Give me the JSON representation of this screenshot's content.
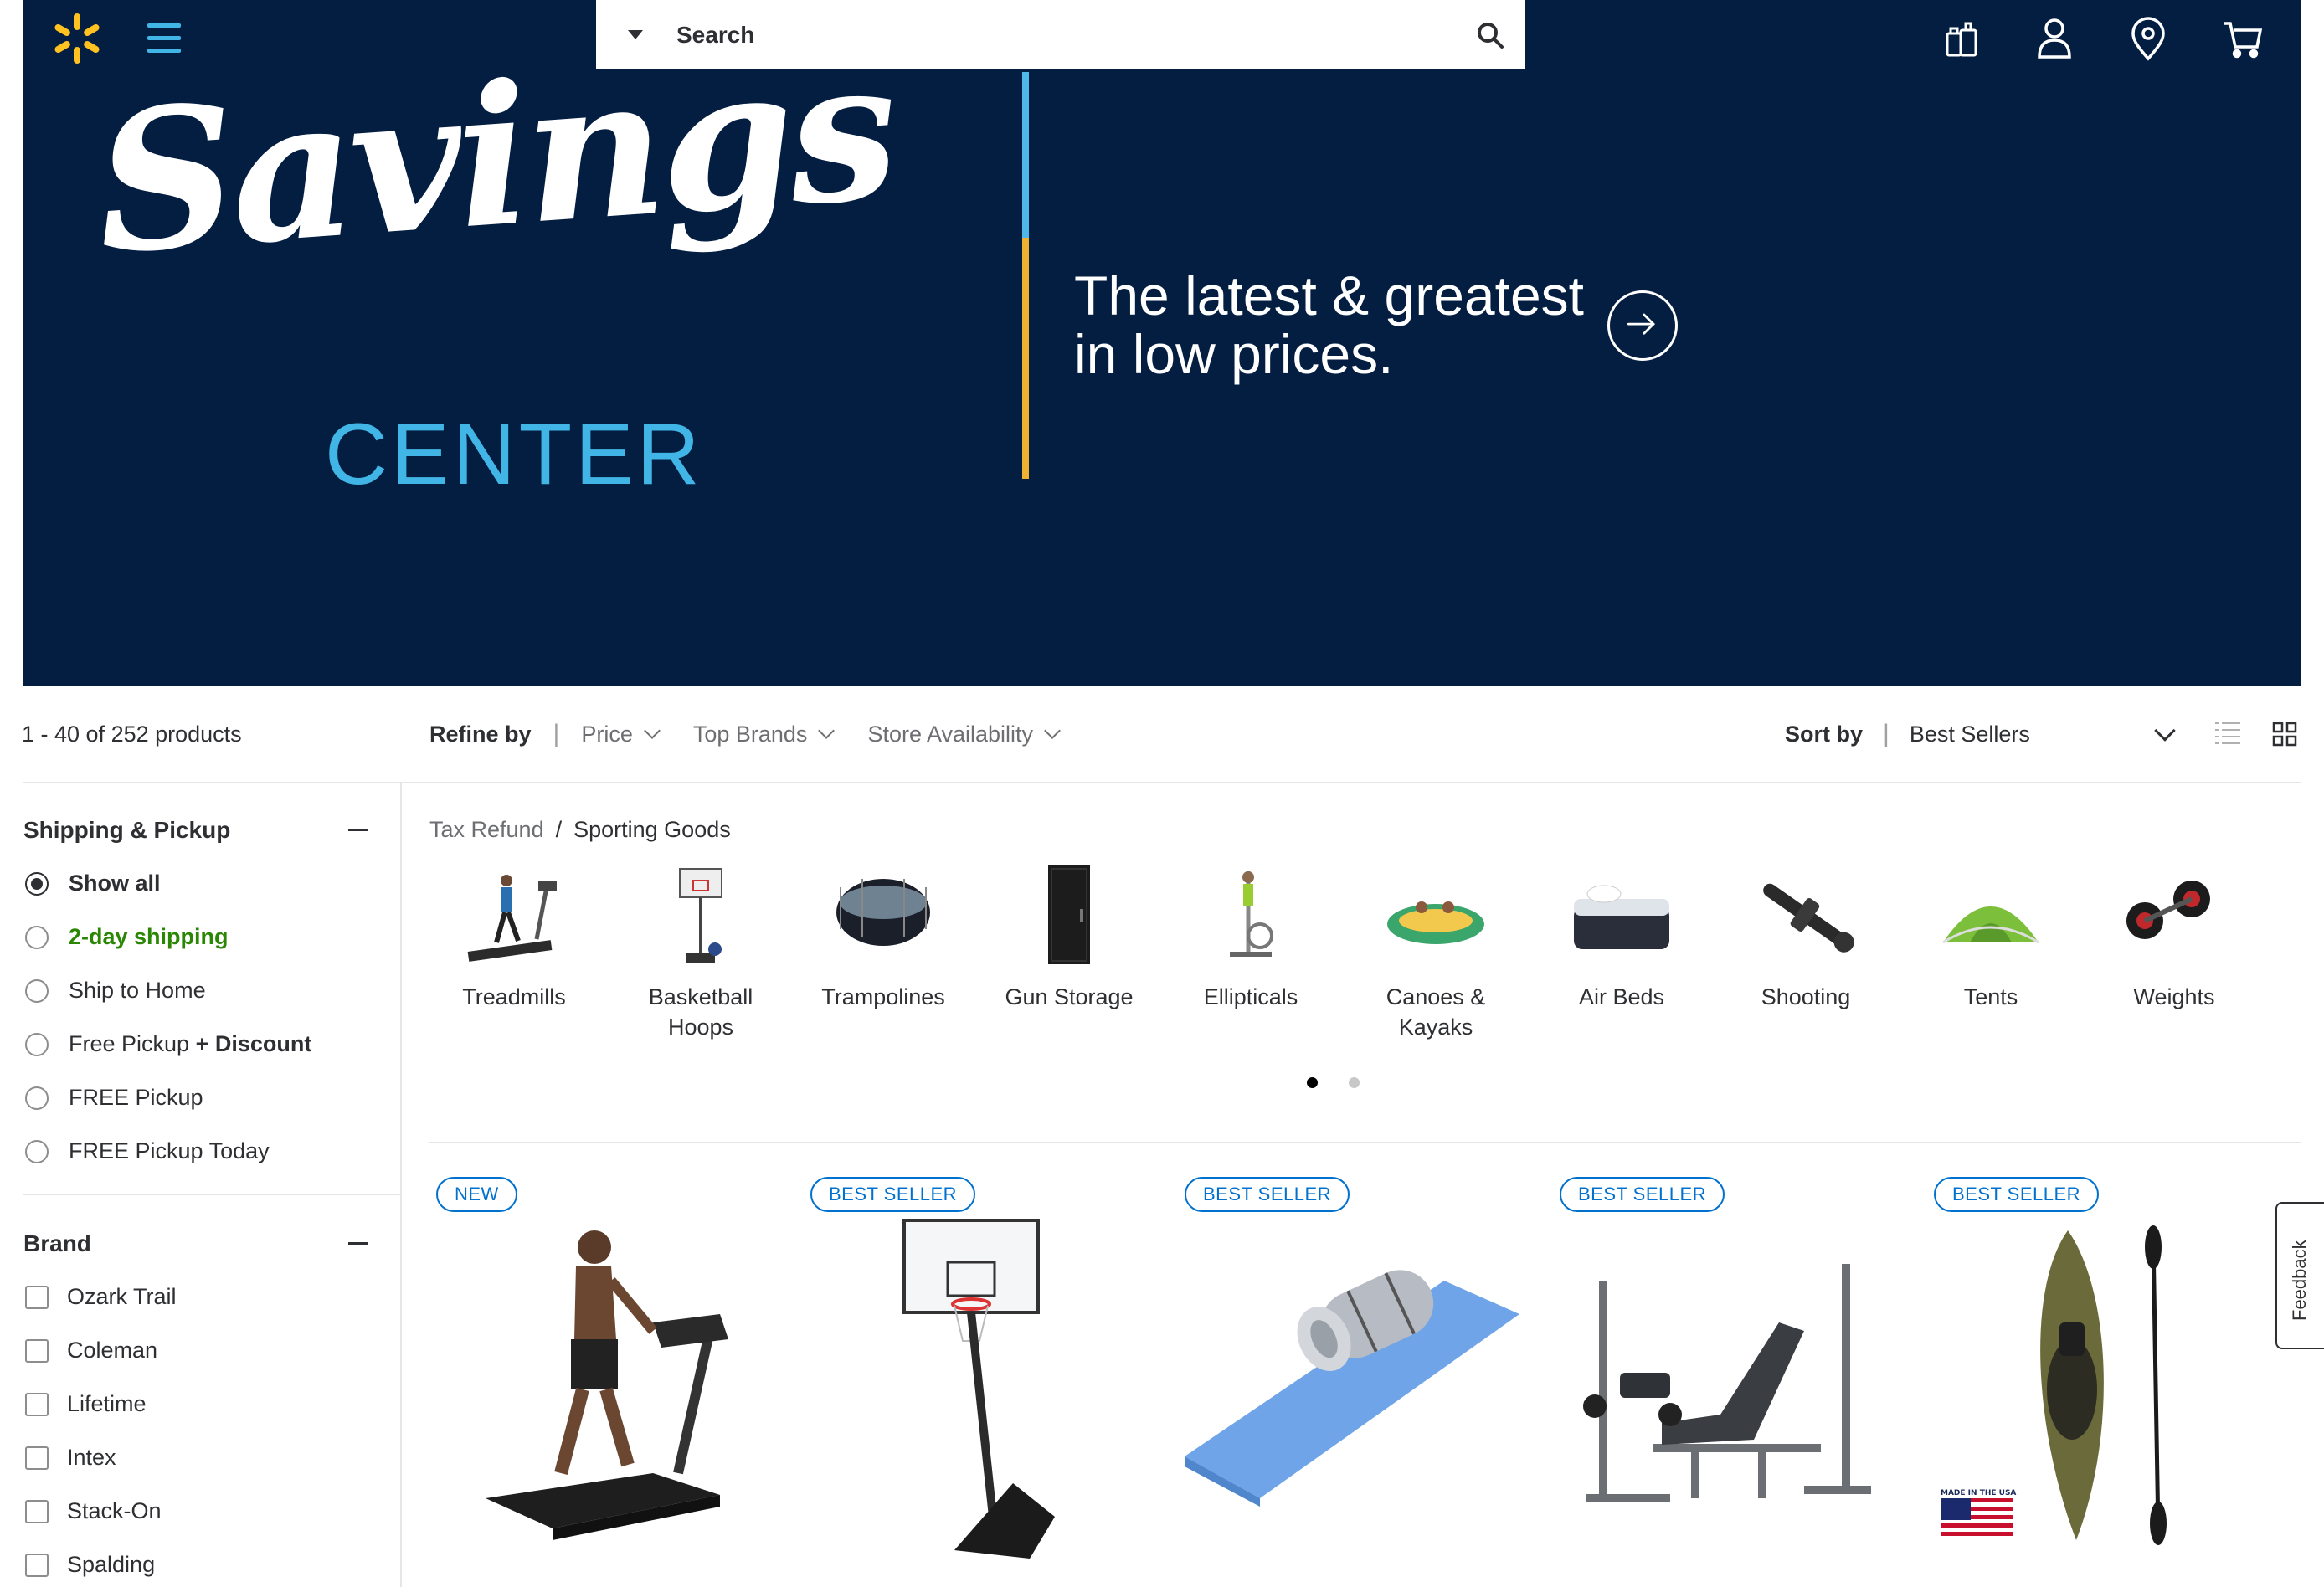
{
  "header": {
    "search_placeholder": "Search",
    "icons": [
      "spark-logo-icon",
      "menu-icon",
      "search-icon",
      "gift-reorder-icon",
      "account-icon",
      "location-pin-icon",
      "cart-icon"
    ]
  },
  "hero": {
    "script_word": "Savings",
    "center_word": "CENTER",
    "tagline_line1": "The latest & greatest",
    "tagline_line2": "in low prices.",
    "colors": {
      "background": "#041e42",
      "blue": "#41b6e6",
      "yellow": "#f0b133"
    }
  },
  "toolbar": {
    "count": "1 - 40 of 252 products",
    "refine_label": "Refine by",
    "refine_options": [
      "Price",
      "Top Brands",
      "Store Availability"
    ],
    "sort_label": "Sort by",
    "sort_value": "Best Sellers"
  },
  "sidebar": {
    "shipping": {
      "title": "Shipping & Pickup",
      "options": [
        {
          "label": "Show all",
          "selected": true
        },
        {
          "label": "2-day shipping",
          "selected": false
        },
        {
          "label": "Ship to Home",
          "selected": false
        },
        {
          "label": "Free Pickup",
          "suffix": "+ Discount",
          "selected": false
        },
        {
          "label": "FREE Pickup",
          "selected": false
        },
        {
          "label": "FREE Pickup Today",
          "selected": false
        }
      ]
    },
    "brand": {
      "title": "Brand",
      "options": [
        "Ozark Trail",
        "Coleman",
        "Lifetime",
        "Intex",
        "Stack-On",
        "Spalding"
      ]
    }
  },
  "breadcrumb": {
    "parent": "Tax Refund",
    "separator": "/",
    "current": "Sporting Goods"
  },
  "categories": [
    {
      "label": "Treadmills"
    },
    {
      "label": "Basketball Hoops"
    },
    {
      "label": "Trampolines"
    },
    {
      "label": "Gun Storage"
    },
    {
      "label": "Ellipticals"
    },
    {
      "label": "Canoes & Kayaks"
    },
    {
      "label": "Air Beds"
    },
    {
      "label": "Shooting"
    },
    {
      "label": "Tents"
    },
    {
      "label": "Weights"
    }
  ],
  "carousel": {
    "page": 1,
    "pages": 2
  },
  "products": [
    {
      "badge": "NEW",
      "image": "treadmill"
    },
    {
      "badge": "BEST SELLER",
      "image": "basketball-hoop"
    },
    {
      "badge": "BEST SELLER",
      "image": "sleeping-pad"
    },
    {
      "badge": "BEST SELLER",
      "image": "weight-bench"
    },
    {
      "badge": "BEST SELLER",
      "image": "kayak",
      "flag_text": "MADE IN THE USA"
    }
  ],
  "feedback_label": "Feedback"
}
